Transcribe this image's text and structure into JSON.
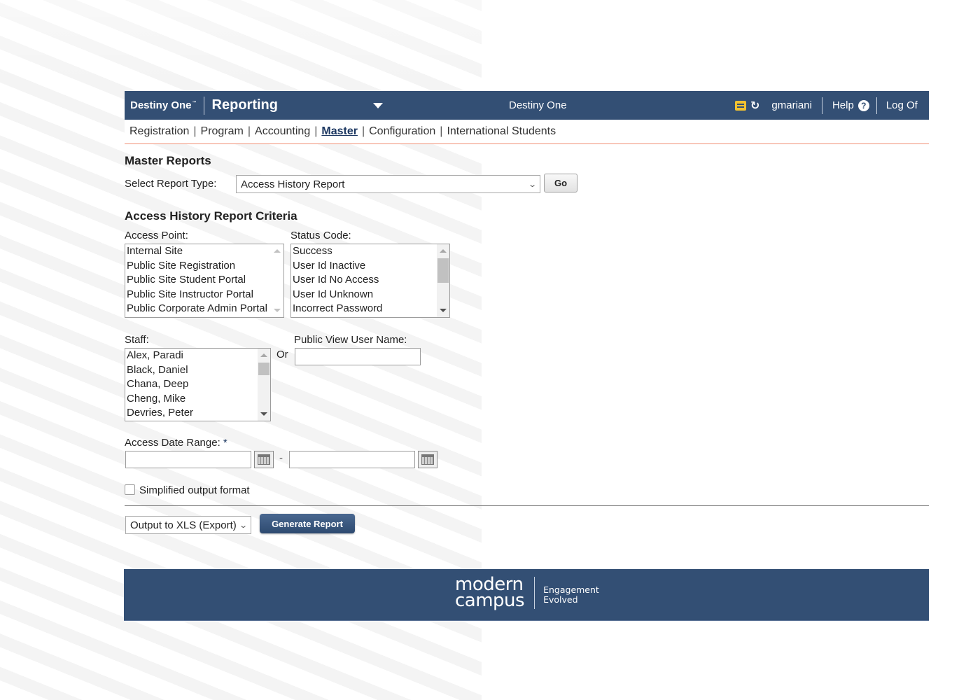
{
  "header": {
    "brand": "Destiny One",
    "brand_tm": "™",
    "module": "Reporting",
    "center_title": "Destiny One",
    "icons": {
      "mail": "mail-icon",
      "history": "history-icon",
      "help": "help-circle-icon",
      "module_menu": "caret-down-icon"
    },
    "username": "gmariani",
    "help_label": "Help",
    "help_glyph": "?",
    "history_glyph": "↺",
    "logoff_label": "Log Of"
  },
  "nav": {
    "links": [
      {
        "label": "Registration",
        "active": false
      },
      {
        "label": "Program",
        "active": false
      },
      {
        "label": "Accounting",
        "active": false
      },
      {
        "label": "Master",
        "active": true
      },
      {
        "label": "Configuration",
        "active": false
      },
      {
        "label": "International Students",
        "active": false
      }
    ],
    "separator": "|"
  },
  "master": {
    "title": "Master Reports",
    "report_type_label": "Select Report Type:",
    "report_type_value": "Access History Report",
    "go_label": "Go",
    "chevron": "⌄"
  },
  "criteria": {
    "title": "Access History Report Criteria",
    "access_point": {
      "label": "Access Point:",
      "options": [
        "Internal Site",
        "Public Site Registration",
        "Public Site Student Portal",
        "Public Site Instructor Portal",
        "Public Corporate Admin Portal"
      ]
    },
    "status_code": {
      "label": "Status Code:",
      "options": [
        "Success",
        "User Id Inactive",
        "User Id No Access",
        "User Id Unknown",
        "Incorrect Password"
      ]
    },
    "staff": {
      "label": "Staff:",
      "options": [
        "Alex, Paradi",
        "Black, Daniel",
        "Chana, Deep",
        "Cheng, Mike",
        "Devries, Peter"
      ]
    },
    "or_label": "Or",
    "public_user": {
      "label": "Public View User Name:",
      "value": ""
    },
    "date_range": {
      "label": "Access Date Range:",
      "required_marker": "*",
      "from_value": "",
      "to_value": "",
      "separator": "-"
    },
    "simplified": {
      "label": "Simplified output format",
      "checked": false
    }
  },
  "actions": {
    "output_value": "Output to XLS (Export)",
    "generate_label": "Generate Report"
  },
  "footer": {
    "logo_line1": "modern",
    "logo_line2": "campus",
    "tagline1": "Engagement",
    "tagline2": "Evolved"
  },
  "colors": {
    "primary": "#334f74",
    "accent_line": "#f08f75",
    "mail_icon": "#f2c230"
  }
}
